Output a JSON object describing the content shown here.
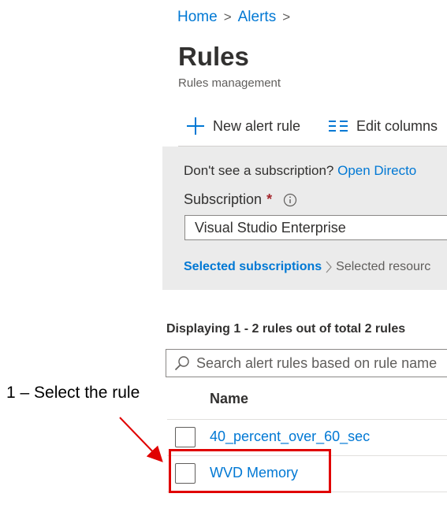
{
  "breadcrumb": {
    "items": [
      "Home",
      "Alerts"
    ],
    "separator": ">"
  },
  "page": {
    "title": "Rules",
    "subtitle": "Rules management"
  },
  "toolbar": {
    "new_alert_rule": "New alert rule",
    "edit_columns": "Edit columns"
  },
  "filter": {
    "notice_prefix": "Don't see a subscription?",
    "notice_link": "Open Directo",
    "subscription_label": "Subscription",
    "required_mark": "*",
    "subscription_value": "Visual Studio Enterprise",
    "selected_subscriptions": "Selected subscriptions",
    "selected_resources": "Selected resourc"
  },
  "list": {
    "count_text": "Displaying 1 - 2 rules out of total 2 rules",
    "search_placeholder": "Search alert rules based on rule name",
    "column_name": "Name",
    "rows": [
      {
        "name": "40_percent_over_60_sec"
      },
      {
        "name": "WVD Memory"
      }
    ]
  },
  "annotation": {
    "text": "1 – Select the rule"
  },
  "colors": {
    "accent": "#0078d4",
    "highlight": "#e00000",
    "required": "#a4262c",
    "panel_bg": "#ebebeb"
  }
}
